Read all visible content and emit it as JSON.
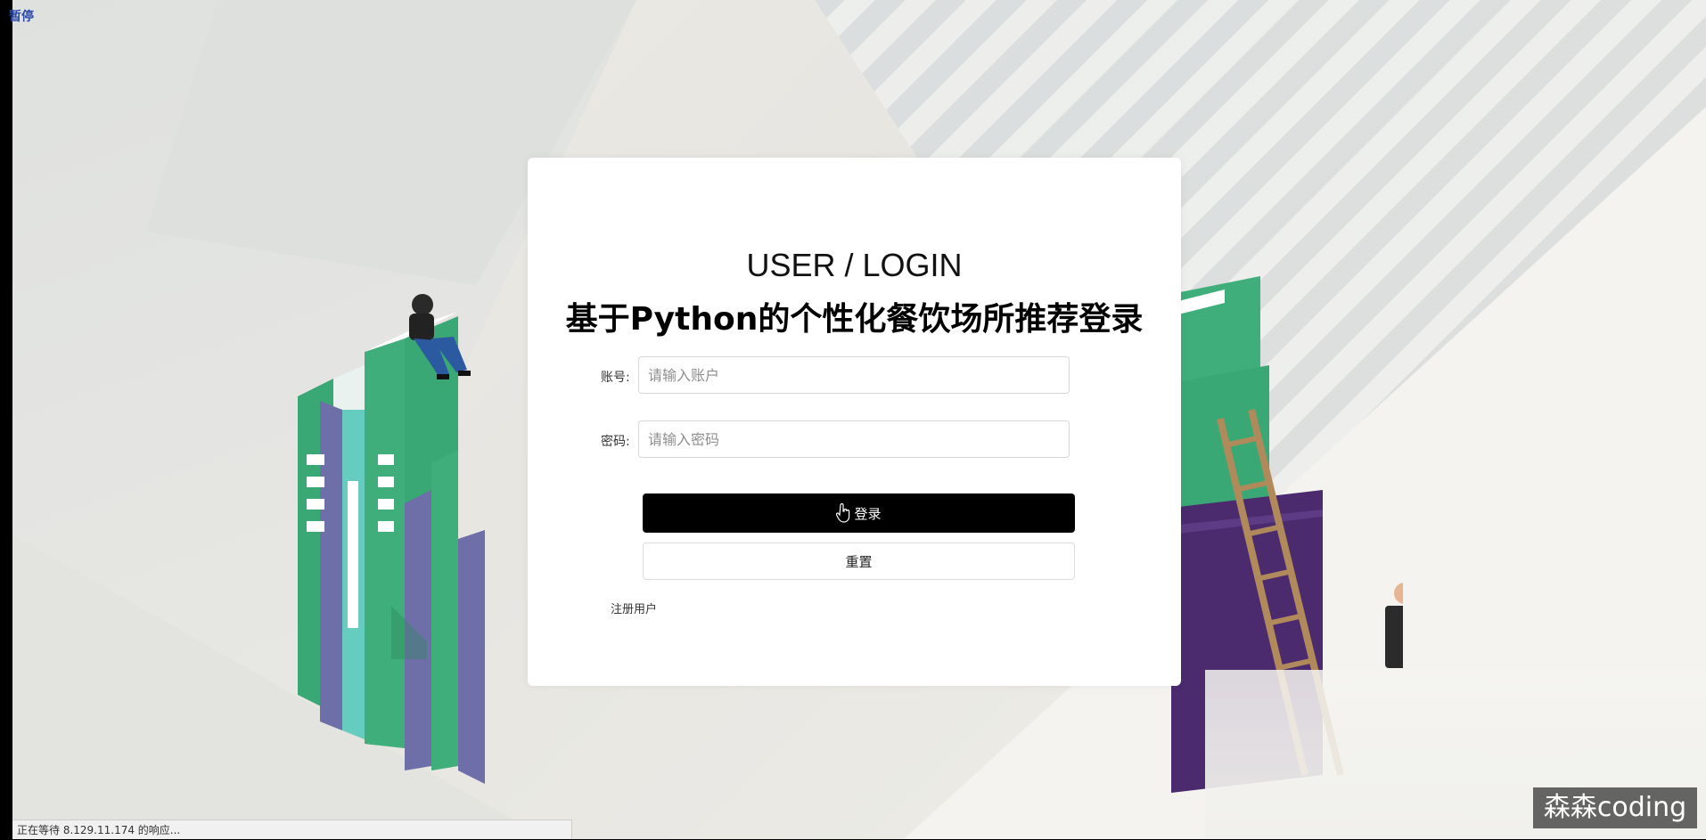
{
  "overlay": {
    "pause_label": "暂停"
  },
  "login": {
    "subtitle": "USER / LOGIN",
    "title": "基于Python的个性化餐饮场所推荐登录",
    "account_label": "账号:",
    "account_placeholder": "请输入账户",
    "password_label": "密码:",
    "password_placeholder": "请输入密码",
    "login_button": "登录",
    "reset_button": "重置",
    "register_link": "注册用户"
  },
  "status_bar": {
    "text": "正在等待 8.129.11.174 的响应..."
  },
  "watermark": {
    "text": "森森coding"
  },
  "colors": {
    "book_green": "#3fae7a",
    "book_purple": "#6e6ea8",
    "book_teal": "#66ccc0",
    "book_dark_purple": "#4b2b6e",
    "button_black": "#000000"
  }
}
